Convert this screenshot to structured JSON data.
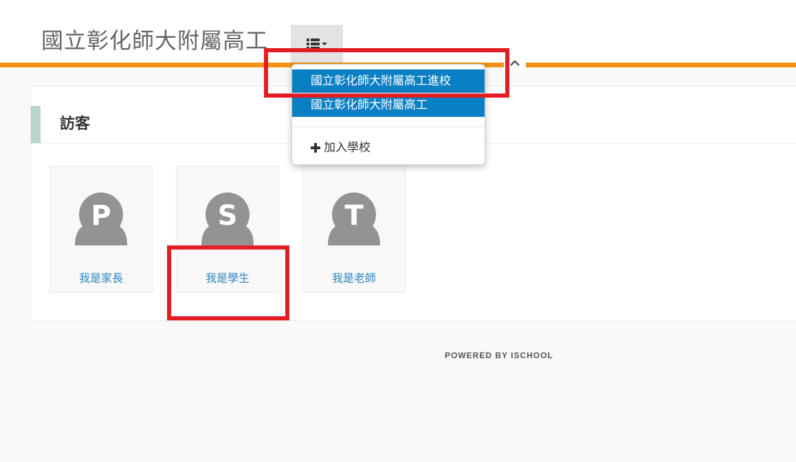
{
  "header": {
    "school_name": "國立彰化師大附屬高工",
    "menu_icon": "list-icon",
    "caret_icon": "caret-down-icon"
  },
  "dropdown": {
    "items": [
      {
        "label": "國立彰化師大附屬高工進校"
      },
      {
        "label": "國立彰化師大附屬高工"
      }
    ],
    "add_school_label": "加入學校",
    "add_icon": "plus-icon",
    "collapse_icon": "chevron-up-icon"
  },
  "section": {
    "title": "訪客"
  },
  "roles": [
    {
      "letter": "P",
      "label": "我是家長"
    },
    {
      "letter": "S",
      "label": "我是學生"
    },
    {
      "letter": "T",
      "label": "我是老師"
    }
  ],
  "footer": {
    "powered_by": "POWERED BY ISCHOOL"
  },
  "colors": {
    "accent_orange": "#f39214",
    "menu_blue": "#0a80c4",
    "link_blue": "#2d85be",
    "section_bar": "#b9d3cd",
    "highlight_red": "#e41d25",
    "avatar_gray": "#939393"
  }
}
